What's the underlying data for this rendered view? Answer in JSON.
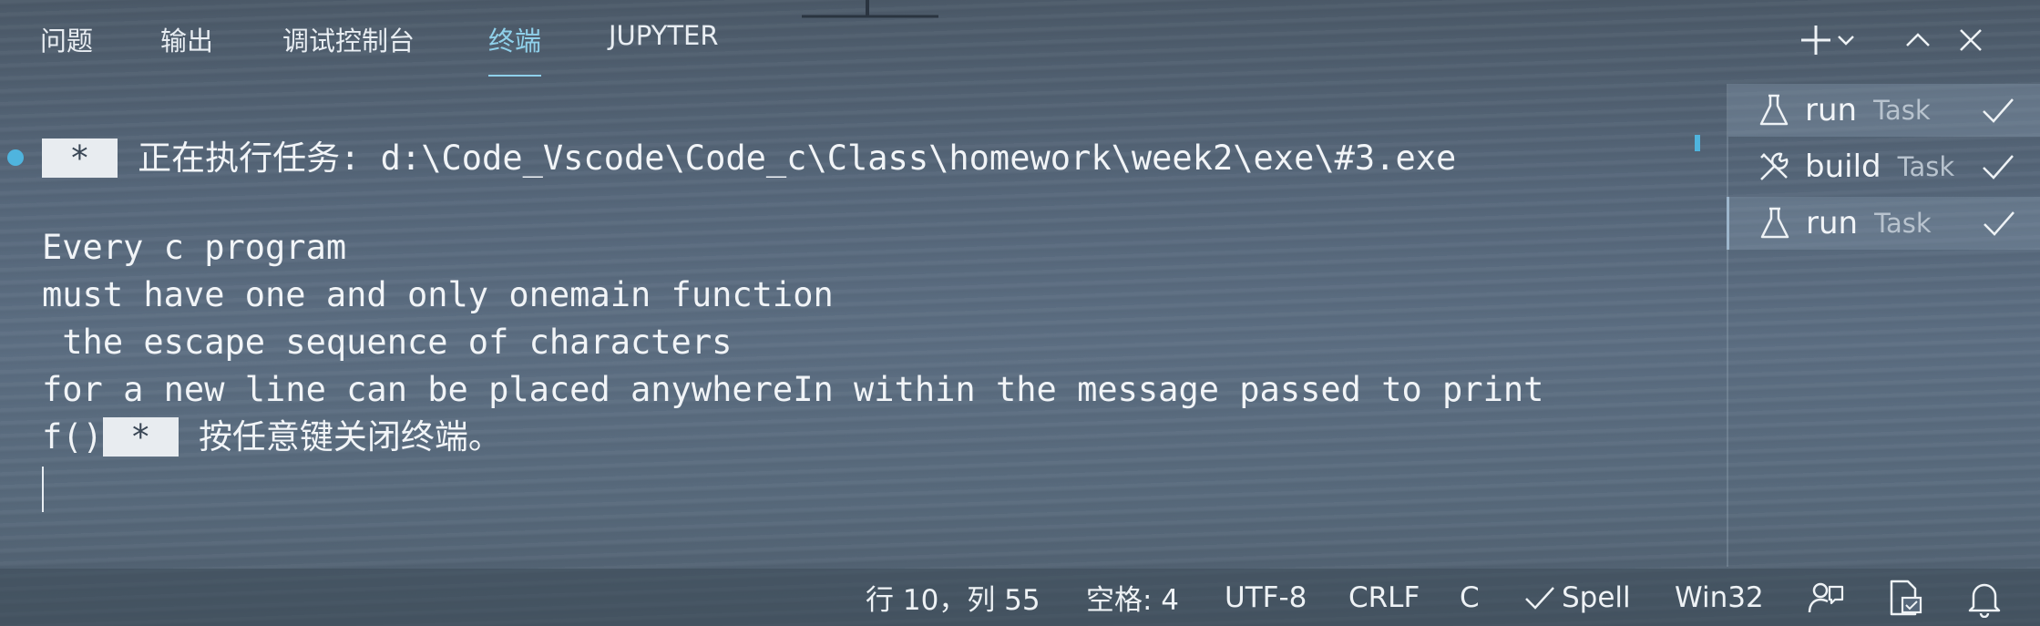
{
  "panel": {
    "tabs": [
      {
        "label": "问题"
      },
      {
        "label": "输出"
      },
      {
        "label": "调试控制台"
      },
      {
        "label": "终端"
      },
      {
        "label": "JUPYTER"
      }
    ],
    "active_tab": "终端"
  },
  "terminal": {
    "task_marker": " * ",
    "task_header": "正在执行任务: d:\\Code_Vscode\\Code_c\\Class\\homework\\week2\\exe\\#3.exe",
    "output_lines": [
      "Every c program",
      "must have one and only onemain function",
      " the escape sequence of characters",
      "for a new line can be placed anywhereIn within the message passed to print"
    ],
    "last_line_prefix": "f()",
    "close_marker": " * ",
    "close_message": "按任意键关闭终端。"
  },
  "tasks": [
    {
      "name": "run",
      "type": "Task",
      "icon": "flask-icon"
    },
    {
      "name": "build",
      "type": "Task",
      "icon": "tools-icon"
    },
    {
      "name": "run",
      "type": "Task",
      "icon": "flask-icon"
    }
  ],
  "statusbar": {
    "position": "行 10，列 55",
    "indent": "空格: 4",
    "encoding": "UTF-8",
    "eol": "CRLF",
    "language": "C",
    "spell": "Spell",
    "platform": "Win32"
  },
  "colors": {
    "accent": "#8fd0ea",
    "task_dot": "#4fb4de"
  }
}
